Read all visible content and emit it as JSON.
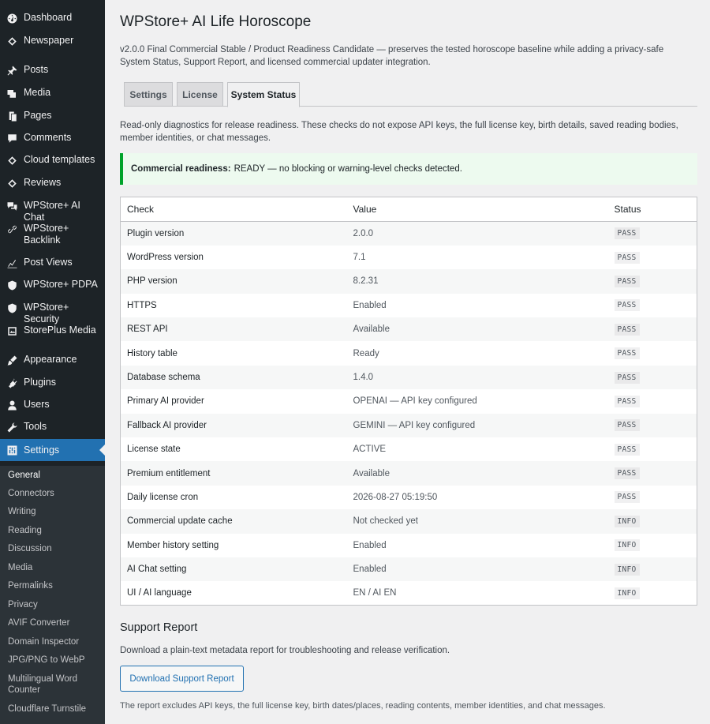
{
  "sidebar": {
    "items": [
      {
        "label": "Dashboard",
        "icon": "dashboard-icon"
      },
      {
        "label": "Newspaper",
        "icon": "newspaper-icon"
      },
      {
        "label": "Posts",
        "icon": "pin-icon"
      },
      {
        "label": "Media",
        "icon": "media-icon"
      },
      {
        "label": "Pages",
        "icon": "pages-icon"
      },
      {
        "label": "Comments",
        "icon": "comments-icon"
      },
      {
        "label": "Cloud templates",
        "icon": "diamond-icon"
      },
      {
        "label": "Reviews",
        "icon": "diamond-icon"
      },
      {
        "label": "WPStore+ AI Chat",
        "icon": "chat-icon"
      },
      {
        "label": "WPStore+ Backlink",
        "icon": "link-icon"
      },
      {
        "label": "Post Views",
        "icon": "chart-icon"
      },
      {
        "label": "WPStore+ PDPA",
        "icon": "shield-icon"
      },
      {
        "label": "WPStore+ Security",
        "icon": "shield-icon"
      },
      {
        "label": "StorePlus Media",
        "icon": "media-icon"
      },
      {
        "label": "Appearance",
        "icon": "brush-icon"
      },
      {
        "label": "Plugins",
        "icon": "plugin-icon"
      },
      {
        "label": "Users",
        "icon": "user-icon"
      },
      {
        "label": "Tools",
        "icon": "wrench-icon"
      },
      {
        "label": "Settings",
        "icon": "settings-icon"
      }
    ],
    "submenu": [
      "General",
      "Connectors",
      "Writing",
      "Reading",
      "Discussion",
      "Media",
      "Permalinks",
      "Privacy",
      "AVIF Converter",
      "Domain Inspector",
      "JPG/PNG to WebP",
      "Multilingual Word Counter",
      "Cloudflare Turnstile"
    ]
  },
  "page": {
    "title": "WPStore+ AI Life Horoscope",
    "intro": "v2.0.0 Final Commercial Stable / Product Readiness Candidate — preserves the tested horoscope baseline while adding a privacy-safe System Status, Support Report, and licensed commercial updater integration.",
    "tabs": [
      "Settings",
      "License",
      "System Status"
    ],
    "description": "Read-only diagnostics for release readiness. These checks do not expose API keys, the full license key, birth details, saved reading bodies, member identities, or chat messages.",
    "notice_label": "Commercial readiness:",
    "notice_text": "READY — no blocking or warning-level checks detected."
  },
  "table": {
    "headers": [
      "Check",
      "Value",
      "Status"
    ],
    "rows": [
      [
        "Plugin version",
        "2.0.0",
        "PASS"
      ],
      [
        "WordPress version",
        "7.1",
        "PASS"
      ],
      [
        "PHP version",
        "8.2.31",
        "PASS"
      ],
      [
        "HTTPS",
        "Enabled",
        "PASS"
      ],
      [
        "REST API",
        "Available",
        "PASS"
      ],
      [
        "History table",
        "Ready",
        "PASS"
      ],
      [
        "Database schema",
        "1.4.0",
        "PASS"
      ],
      [
        "Primary AI provider",
        "OPENAI — API key configured",
        "PASS"
      ],
      [
        "Fallback AI provider",
        "GEMINI — API key configured",
        "PASS"
      ],
      [
        "License state",
        "ACTIVE",
        "PASS"
      ],
      [
        "Premium entitlement",
        "Available",
        "PASS"
      ],
      [
        "Daily license cron",
        "2026-08-27 05:19:50",
        "PASS"
      ],
      [
        "Commercial update cache",
        "Not checked yet",
        "INFO"
      ],
      [
        "Member history setting",
        "Enabled",
        "INFO"
      ],
      [
        "AI Chat setting",
        "Enabled",
        "INFO"
      ],
      [
        "UI / AI language",
        "EN / AI EN",
        "INFO"
      ]
    ]
  },
  "support": {
    "title": "Support Report",
    "description": "Download a plain-text metadata report for troubleshooting and release verification.",
    "button": "Download Support Report",
    "note": "The report excludes API keys, the full license key, birth dates/places, reading contents, member identities, and chat messages."
  },
  "colors": {
    "sidebar_bg": "#1d2327",
    "accent": "#2271b1",
    "success": "#00a32a"
  }
}
